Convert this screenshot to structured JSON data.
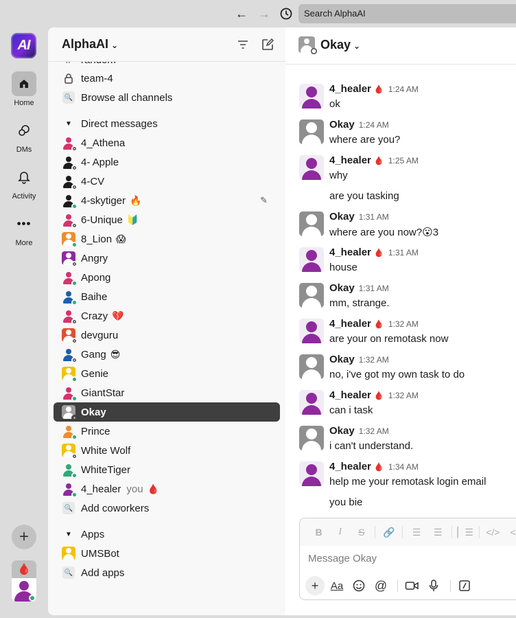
{
  "topbar": {
    "search_placeholder": "Search AlphaAI",
    "back_icon": "arrow-left-icon",
    "forward_icon": "arrow-right-icon",
    "history_icon": "clock-icon"
  },
  "rail": {
    "logo_text": "AI",
    "items": [
      {
        "label": "Home",
        "icon": "home-icon"
      },
      {
        "label": "DMs",
        "icon": "dms-icon"
      },
      {
        "label": "Activity",
        "icon": "bell-icon"
      },
      {
        "label": "More",
        "icon": "more-icon"
      }
    ]
  },
  "workspace": {
    "name": "AlphaAI"
  },
  "sidebar": {
    "partial_channel": "random",
    "channels": [
      {
        "name": "team-4"
      }
    ],
    "browse_channels": "Browse all channels",
    "dm_section": "Direct messages",
    "dms": [
      {
        "name": "4_Athena",
        "emoji": "",
        "color": "#d6336c",
        "status": "away"
      },
      {
        "name": "4- Apple",
        "emoji": "",
        "color": "#1d1c1d",
        "status": "away"
      },
      {
        "name": "4-CV",
        "emoji": "",
        "color": "#1d1c1d",
        "status": "away"
      },
      {
        "name": "4-skytiger",
        "emoji": "🔥",
        "color": "#1d1c1d",
        "status": "online"
      },
      {
        "name": "6-Unique",
        "emoji": "🔰",
        "color": "#d6336c",
        "status": "away"
      },
      {
        "name": "8_Lion",
        "emoji": "😱",
        "color": "#f08c2a",
        "status": "online",
        "boxed": true
      },
      {
        "name": "Angry",
        "emoji": "",
        "color": "#8e2a9e",
        "status": "away",
        "boxed": true
      },
      {
        "name": "Apong",
        "emoji": "",
        "color": "#d6336c",
        "status": "online"
      },
      {
        "name": "Baihe",
        "emoji": "",
        "color": "#1f5fa8",
        "status": "online"
      },
      {
        "name": "Crazy",
        "emoji": "💔",
        "color": "#d6336c",
        "status": "away"
      },
      {
        "name": "devguru",
        "emoji": "",
        "color": "#e2502c",
        "status": "away",
        "boxed": true
      },
      {
        "name": "Gang",
        "emoji": "😎",
        "color": "#1f5fa8",
        "status": "away"
      },
      {
        "name": "Genie",
        "emoji": "",
        "color": "#f2c200",
        "status": "online",
        "boxed": true
      },
      {
        "name": "GiantStar",
        "emoji": "",
        "color": "#d6336c",
        "status": "online"
      },
      {
        "name": "Okay",
        "emoji": "",
        "color": "#9e9e9e",
        "status": "away",
        "boxed": true,
        "selected": true
      },
      {
        "name": "Prince",
        "emoji": "",
        "color": "#f08c2a",
        "status": "online"
      },
      {
        "name": "White Wolf",
        "emoji": "",
        "color": "#f2c200",
        "status": "away",
        "boxed": true
      },
      {
        "name": "WhiteTiger",
        "emoji": "",
        "color": "#2bac76",
        "status": "online"
      },
      {
        "name": "4_healer",
        "emoji": "🩸",
        "color": "#8e2a9e",
        "status": "online",
        "you": "you"
      }
    ],
    "add_coworkers": "Add coworkers",
    "apps_section": "Apps",
    "apps": [
      {
        "name": "UMSBot"
      }
    ],
    "add_apps": "Add apps"
  },
  "channel": {
    "title": "Okay"
  },
  "messages": [
    {
      "author": "4_healer",
      "badge": "🩸",
      "time": "1:24 AM",
      "lines": [
        "ok"
      ],
      "avatar": "purple"
    },
    {
      "author": "Okay",
      "badge": "",
      "time": "1:24 AM",
      "lines": [
        "where are you?"
      ],
      "avatar": "gray"
    },
    {
      "author": "4_healer",
      "badge": "🩸",
      "time": "1:25 AM",
      "lines": [
        "why",
        "are you tasking"
      ],
      "avatar": "purple"
    },
    {
      "author": "Okay",
      "badge": "",
      "time": "1:31 AM",
      "lines": [
        "where are you now?😮3"
      ],
      "avatar": "gray"
    },
    {
      "author": "4_healer",
      "badge": "🩸",
      "time": "1:31 AM",
      "lines": [
        "house"
      ],
      "avatar": "purple"
    },
    {
      "author": "Okay",
      "badge": "",
      "time": "1:31 AM",
      "lines": [
        "mm, strange."
      ],
      "avatar": "gray"
    },
    {
      "author": "4_healer",
      "badge": "🩸",
      "time": "1:32 AM",
      "lines": [
        "are your on remotask now"
      ],
      "avatar": "purple"
    },
    {
      "author": "Okay",
      "badge": "",
      "time": "1:32 AM",
      "lines": [
        "no, i've got my own task to do"
      ],
      "avatar": "gray"
    },
    {
      "author": "4_healer",
      "badge": "🩸",
      "time": "1:32 AM",
      "lines": [
        "can i task"
      ],
      "avatar": "purple"
    },
    {
      "author": "Okay",
      "badge": "",
      "time": "1:32 AM",
      "lines": [
        "i can't understand."
      ],
      "avatar": "gray"
    },
    {
      "author": "4_healer",
      "badge": "🩸",
      "time": "1:34 AM",
      "lines": [
        "help me your remotask login email",
        "you bie"
      ],
      "avatar": "purple"
    }
  ],
  "composer": {
    "placeholder": "Message Okay",
    "format_buttons": [
      "B",
      "I",
      "S",
      "link",
      "ordered-list",
      "bulleted-list",
      "quote",
      "code",
      "code-block"
    ]
  },
  "colors": {
    "accent_dark": "#3f3f3f",
    "purple": "#8e2a9e",
    "online": "#2bac76",
    "drop_red": "#d62030"
  }
}
